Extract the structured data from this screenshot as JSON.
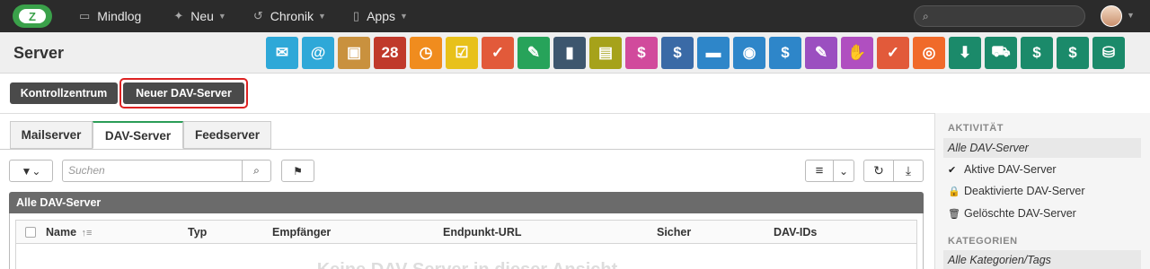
{
  "topbar": {
    "logo_letter": "Z",
    "nav": [
      {
        "label": "Mindlog",
        "icon": "chat-icon",
        "glyph": "▭"
      },
      {
        "label": "Neu",
        "icon": "sparkle-icon",
        "glyph": "✦"
      },
      {
        "label": "Chronik",
        "icon": "history-icon",
        "glyph": "↺"
      },
      {
        "label": "Apps",
        "icon": "tablet-icon",
        "glyph": "▯"
      }
    ],
    "search_placeholder": ""
  },
  "titlebar": {
    "title": "Server",
    "apps": [
      {
        "icon": "mail-icon",
        "glyph": "✉",
        "color": "#2ea8d8"
      },
      {
        "icon": "address-icon",
        "glyph": "@",
        "color": "#2ea8d8"
      },
      {
        "icon": "contacts-icon",
        "glyph": "▣",
        "color": "#c9913e"
      },
      {
        "icon": "calendar-icon",
        "glyph": "28",
        "color": "#c0392b"
      },
      {
        "icon": "timer-icon",
        "glyph": "◷",
        "color": "#f08c1e"
      },
      {
        "icon": "tasks-icon",
        "glyph": "☑",
        "color": "#e8c11a"
      },
      {
        "icon": "folder-check-icon",
        "glyph": "✓",
        "color": "#e25a3a"
      },
      {
        "icon": "notes-icon",
        "glyph": "✎",
        "color": "#27a35a"
      },
      {
        "icon": "bookmark-icon",
        "glyph": "▮",
        "color": "#3d566e"
      },
      {
        "icon": "document-icon",
        "glyph": "▤",
        "color": "#a6a21a"
      },
      {
        "icon": "cashier-icon",
        "glyph": "$",
        "color": "#d14a9c"
      },
      {
        "icon": "dollar-icon",
        "glyph": "$",
        "color": "#3a6aa6"
      },
      {
        "icon": "truck-icon",
        "glyph": "▬",
        "color": "#2e86c9"
      },
      {
        "icon": "support-icon",
        "glyph": "◉",
        "color": "#2e86c9"
      },
      {
        "icon": "money-bag-icon",
        "glyph": "$",
        "color": "#2e86c9"
      },
      {
        "icon": "certificate-icon",
        "glyph": "✎",
        "color": "#9b4fc0"
      },
      {
        "icon": "handshake-icon",
        "glyph": "✋",
        "color": "#b04fc0"
      },
      {
        "icon": "contract-icon",
        "glyph": "✓",
        "color": "#e25a3a"
      },
      {
        "icon": "broadcast-icon",
        "glyph": "◎",
        "color": "#f06a2a"
      },
      {
        "icon": "download-icon",
        "glyph": "⬇",
        "color": "#1b8a6a"
      },
      {
        "icon": "cart-icon",
        "glyph": "⛟",
        "color": "#1b8a6a"
      },
      {
        "icon": "cash-icon",
        "glyph": "$",
        "color": "#1b8a6a"
      },
      {
        "icon": "price-tag-icon",
        "glyph": "$",
        "color": "#1b8a6a"
      },
      {
        "icon": "database-icon",
        "glyph": "⛁",
        "color": "#1b8a6a"
      }
    ]
  },
  "actions": {
    "control_center": "Kontrollzentrum",
    "new_dav_server": "Neuer DAV-Server"
  },
  "tabs": [
    {
      "label": "Mailserver"
    },
    {
      "label": "DAV-Server"
    },
    {
      "label": "Feedserver"
    }
  ],
  "toolbar": {
    "filter_glyph": "▼⌄",
    "search_placeholder": "Suchen",
    "search_glyph": "⌕",
    "flag_glyph": "⚑",
    "list_glyph": "≡",
    "list_caret": "⌄",
    "refresh_glyph": "↻",
    "export_glyph": "⤓"
  },
  "grid": {
    "title": "Alle DAV-Server",
    "sort_glyph": "↑≡",
    "columns": [
      "Name",
      "Typ",
      "Empfänger",
      "Endpunkt-URL",
      "Sicher",
      "DAV-IDs"
    ],
    "empty_message": "Keine DAV-Server in dieser Ansicht"
  },
  "sidebar": {
    "activity_heading": "AKTIVITÄT",
    "activity_items": [
      {
        "label": "Alle DAV-Server",
        "glyph": ""
      },
      {
        "label": "Aktive DAV-Server",
        "glyph": "✔"
      },
      {
        "label": "Deaktivierte DAV-Server",
        "glyph": "🔒"
      },
      {
        "label": "Gelöschte DAV-Server",
        "glyph": "🗑"
      }
    ],
    "categories_heading": "KATEGORIEN",
    "categories_items": [
      {
        "label": "Alle Kategorien/Tags"
      }
    ]
  }
}
